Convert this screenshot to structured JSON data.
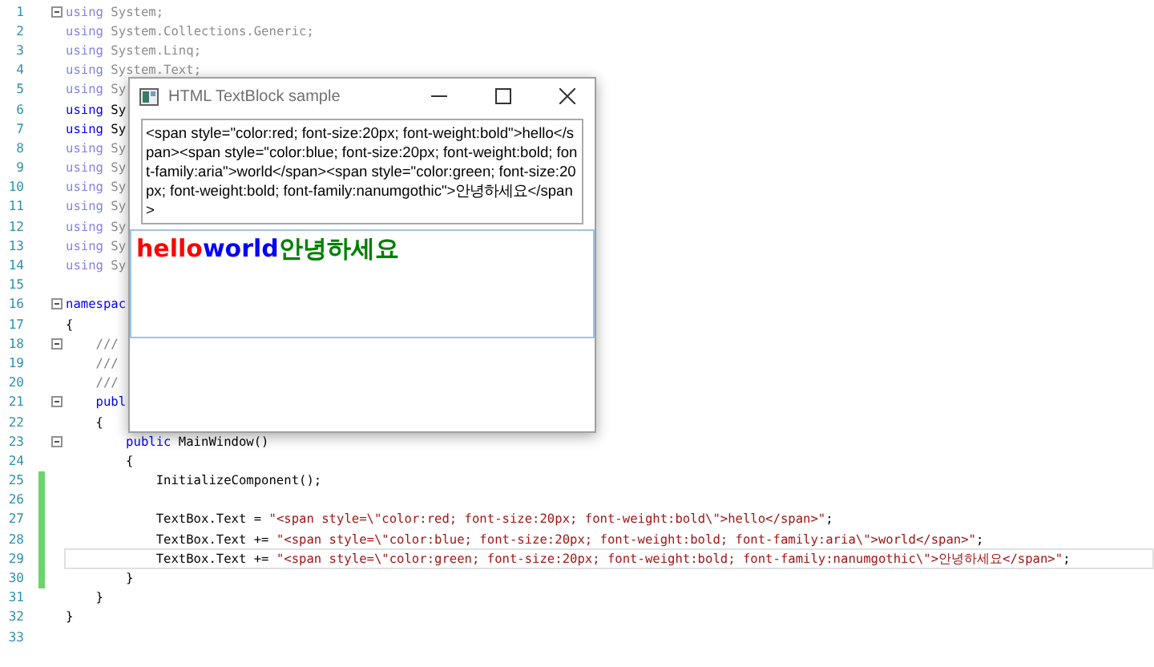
{
  "editor": {
    "lines": [
      {
        "number": "1",
        "fold": true,
        "changed": false,
        "current": false,
        "faded": true,
        "tokens": [
          {
            "kind": "keyword",
            "text": "using"
          },
          {
            "kind": "plain",
            "text": " System;"
          }
        ]
      },
      {
        "number": "2",
        "fold": false,
        "changed": false,
        "current": false,
        "faded": true,
        "tokens": [
          {
            "kind": "keyword",
            "text": "using"
          },
          {
            "kind": "plain",
            "text": " System.Collections.Generic;"
          }
        ]
      },
      {
        "number": "3",
        "fold": false,
        "changed": false,
        "current": false,
        "faded": true,
        "tokens": [
          {
            "kind": "keyword",
            "text": "using"
          },
          {
            "kind": "plain",
            "text": " System.Linq;"
          }
        ]
      },
      {
        "number": "4",
        "fold": false,
        "changed": false,
        "current": false,
        "faded": true,
        "tokens": [
          {
            "kind": "keyword",
            "text": "using"
          },
          {
            "kind": "plain",
            "text": " System.Text;"
          }
        ]
      },
      {
        "number": "5",
        "fold": false,
        "changed": false,
        "current": false,
        "faded": true,
        "tokens": [
          {
            "kind": "keyword",
            "text": "using"
          },
          {
            "kind": "plain",
            "text": " Sy"
          }
        ]
      },
      {
        "number": "6",
        "fold": false,
        "changed": false,
        "current": false,
        "faded": false,
        "tokens": [
          {
            "kind": "keyword",
            "text": "using"
          },
          {
            "kind": "plain",
            "text": " Sy"
          }
        ]
      },
      {
        "number": "7",
        "fold": false,
        "changed": false,
        "current": false,
        "faded": false,
        "tokens": [
          {
            "kind": "keyword",
            "text": "using"
          },
          {
            "kind": "plain",
            "text": " Sy"
          }
        ]
      },
      {
        "number": "8",
        "fold": false,
        "changed": false,
        "current": false,
        "faded": true,
        "tokens": [
          {
            "kind": "keyword",
            "text": "using"
          },
          {
            "kind": "plain",
            "text": " Sy"
          }
        ]
      },
      {
        "number": "9",
        "fold": false,
        "changed": false,
        "current": false,
        "faded": true,
        "tokens": [
          {
            "kind": "keyword",
            "text": "using"
          },
          {
            "kind": "plain",
            "text": " Sy"
          }
        ]
      },
      {
        "number": "10",
        "fold": false,
        "changed": false,
        "current": false,
        "faded": true,
        "tokens": [
          {
            "kind": "keyword",
            "text": "using"
          },
          {
            "kind": "plain",
            "text": " Sy"
          }
        ]
      },
      {
        "number": "11",
        "fold": false,
        "changed": false,
        "current": false,
        "faded": true,
        "tokens": [
          {
            "kind": "keyword",
            "text": "using"
          },
          {
            "kind": "plain",
            "text": " Sy"
          }
        ]
      },
      {
        "number": "12",
        "fold": false,
        "changed": false,
        "current": false,
        "faded": true,
        "tokens": [
          {
            "kind": "keyword",
            "text": "using"
          },
          {
            "kind": "plain",
            "text": " Sy"
          }
        ]
      },
      {
        "number": "13",
        "fold": false,
        "changed": false,
        "current": false,
        "faded": true,
        "tokens": [
          {
            "kind": "keyword",
            "text": "using"
          },
          {
            "kind": "plain",
            "text": " Sy"
          }
        ]
      },
      {
        "number": "14",
        "fold": false,
        "changed": false,
        "current": false,
        "faded": true,
        "tokens": [
          {
            "kind": "keyword",
            "text": "using"
          },
          {
            "kind": "plain",
            "text": " Sy"
          }
        ]
      },
      {
        "number": "15",
        "fold": false,
        "changed": false
      },
      {
        "number": "16",
        "fold": true,
        "changed": false,
        "current": false,
        "faded": false,
        "tokens": [
          {
            "kind": "keyword",
            "text": "namespac"
          }
        ]
      },
      {
        "number": "17",
        "fold": false,
        "changed": false,
        "current": false,
        "faded": false,
        "tokens": [
          {
            "kind": "plain",
            "text": "{"
          }
        ]
      },
      {
        "number": "18",
        "fold": true,
        "changed": false,
        "current": false,
        "faded": false,
        "tokens": [
          {
            "kind": "comment",
            "text": "    ///"
          }
        ]
      },
      {
        "number": "19",
        "fold": false,
        "changed": false,
        "current": false,
        "faded": false,
        "tokens": [
          {
            "kind": "comment",
            "text": "    ///"
          }
        ]
      },
      {
        "number": "20",
        "fold": false,
        "changed": false,
        "current": false,
        "faded": false,
        "tokens": [
          {
            "kind": "comment",
            "text": "    ///"
          }
        ]
      },
      {
        "number": "21",
        "fold": true,
        "changed": false,
        "current": false,
        "faded": false,
        "tokens": [
          {
            "kind": "keyword",
            "text": "    publ"
          }
        ]
      },
      {
        "number": "22",
        "fold": false,
        "changed": false,
        "current": false,
        "faded": false,
        "tokens": [
          {
            "kind": "plain",
            "text": "    {"
          }
        ]
      },
      {
        "number": "23",
        "fold": true,
        "changed": false,
        "current": false,
        "faded": false,
        "tokens": [
          {
            "kind": "keyword",
            "text": "        public"
          },
          {
            "kind": "plain",
            "text": " MainWindow()"
          }
        ]
      },
      {
        "number": "24",
        "fold": false,
        "changed": false,
        "current": false,
        "faded": false,
        "tokens": [
          {
            "kind": "plain",
            "text": "        {"
          }
        ]
      },
      {
        "number": "25",
        "fold": false,
        "changed": true,
        "current": false,
        "faded": false,
        "tokens": [
          {
            "kind": "plain",
            "text": "            InitializeComponent();"
          }
        ]
      },
      {
        "number": "26",
        "fold": false,
        "changed": true
      },
      {
        "number": "27",
        "fold": false,
        "changed": true,
        "current": false,
        "faded": false,
        "tokens": [
          {
            "kind": "plain",
            "text": "            TextBox.Text = "
          },
          {
            "kind": "string",
            "text": "\"<span style=\\\"color:red; font-size:20px; font-weight:bold\\\">hello</span>\""
          },
          {
            "kind": "plain",
            "text": ";"
          }
        ]
      },
      {
        "number": "28",
        "fold": false,
        "changed": true,
        "current": false,
        "faded": false,
        "tokens": [
          {
            "kind": "plain",
            "text": "            TextBox.Text += "
          },
          {
            "kind": "string",
            "text": "\"<span style=\\\"color:blue; font-size:20px; font-weight:bold; font-family:aria\\\">world</span>\""
          },
          {
            "kind": "plain",
            "text": ";"
          }
        ]
      },
      {
        "number": "29",
        "fold": false,
        "changed": true,
        "current": true,
        "faded": false,
        "tokens": [
          {
            "kind": "plain",
            "text": "            TextBox.Text += "
          },
          {
            "kind": "string",
            "text": "\"<span style=\\\"color:green; font-size:20px; font-weight:bold; font-family:nanumgothic\\\">안녕하세요</span>\""
          },
          {
            "kind": "plain",
            "text": ";"
          }
        ]
      },
      {
        "number": "30",
        "fold": false,
        "changed": true,
        "current": false,
        "faded": false,
        "tokens": [
          {
            "kind": "plain",
            "text": "        }"
          }
        ]
      },
      {
        "number": "31",
        "fold": false,
        "changed": false,
        "current": false,
        "faded": false,
        "tokens": [
          {
            "kind": "plain",
            "text": "    }"
          }
        ]
      },
      {
        "number": "32",
        "fold": false,
        "changed": false,
        "current": false,
        "faded": false,
        "tokens": [
          {
            "kind": "plain",
            "text": "}"
          }
        ]
      },
      {
        "number": "33",
        "fold": false,
        "changed": false
      }
    ]
  },
  "window": {
    "title": "HTML TextBlock sample",
    "source": {
      "value": "<span style=\"color:red; font-size:20px; font-weight:bold\">hello</span><span style=\"color:blue; font-size:20px; font-weight:bold; font-family:aria\">world</span><span style=\"color:green; font-size:20px; font-weight:bold; font-family:nanumgothic\">안녕하세요</span>"
    },
    "rendered": [
      {
        "text": "hello",
        "color": "#ff0000"
      },
      {
        "text": "world",
        "color": "#0000ff"
      },
      {
        "text": "안녕하세요",
        "color": "#008000"
      }
    ]
  }
}
